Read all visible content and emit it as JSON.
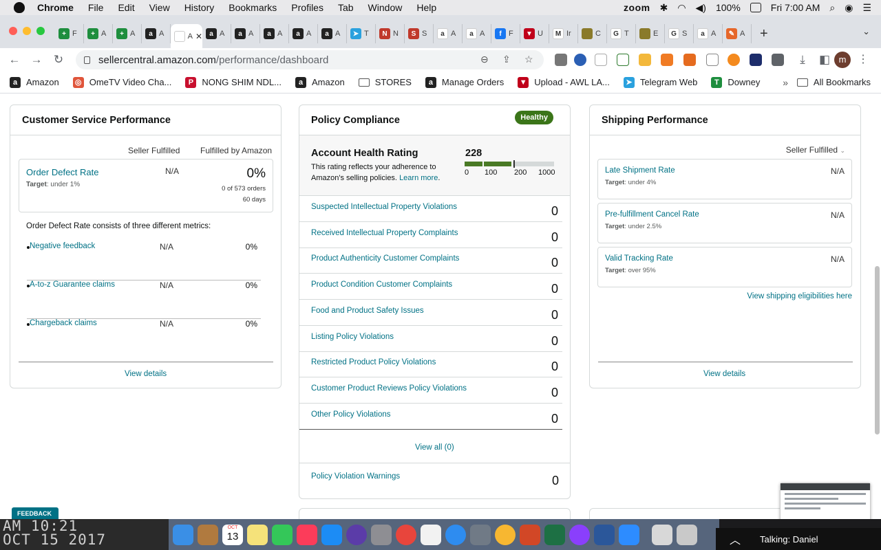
{
  "menubar": {
    "app": "Chrome",
    "items": [
      "File",
      "Edit",
      "View",
      "History",
      "Bookmarks",
      "Profiles",
      "Tab",
      "Window",
      "Help"
    ],
    "zoom": "zoom",
    "battery": "100%",
    "clock": "Fri 7:00 AM"
  },
  "tabs": [
    {
      "label": "F",
      "color": "#1e8e3e",
      "glyph": "+"
    },
    {
      "label": "A",
      "color": "#1e8e3e",
      "glyph": "+"
    },
    {
      "label": "A",
      "color": "#1e8e3e",
      "glyph": "+"
    },
    {
      "label": "A",
      "color": "#222222",
      "glyph": "a"
    },
    {
      "label": "A",
      "color": "#ffffff",
      "glyph": "",
      "active": true
    },
    {
      "label": "A",
      "color": "#222222",
      "glyph": "a"
    },
    {
      "label": "A",
      "color": "#222222",
      "glyph": "a"
    },
    {
      "label": "A",
      "color": "#222222",
      "glyph": "a"
    },
    {
      "label": "A",
      "color": "#222222",
      "glyph": "a"
    },
    {
      "label": "A",
      "color": "#222222",
      "glyph": "a"
    },
    {
      "label": "T",
      "color": "#2aa1de",
      "glyph": "➤"
    },
    {
      "label": "N",
      "color": "#c0392b",
      "glyph": "N"
    },
    {
      "label": "S",
      "color": "#c0392b",
      "glyph": "S"
    },
    {
      "label": "A",
      "color": "#ffffff",
      "glyph": "a"
    },
    {
      "label": "A",
      "color": "#ffffff",
      "glyph": "a"
    },
    {
      "label": "F",
      "color": "#1877f2",
      "glyph": "f"
    },
    {
      "label": "U",
      "color": "#c0001a",
      "glyph": "▼"
    },
    {
      "label": "Ir",
      "color": "#ffffff",
      "glyph": "M"
    },
    {
      "label": "C",
      "color": "#8a7a2a",
      "glyph": ""
    },
    {
      "label": "T",
      "color": "#ffffff",
      "glyph": "G"
    },
    {
      "label": "E",
      "color": "#8a7a2a",
      "glyph": ""
    },
    {
      "label": "S",
      "color": "#ffffff",
      "glyph": "G"
    },
    {
      "label": "A",
      "color": "#ffffff",
      "glyph": "a"
    },
    {
      "label": "A",
      "color": "#e6672a",
      "glyph": "✎"
    }
  ],
  "toolbar": {
    "url_host": "sellercentral.amazon.com",
    "url_path": "/performance/dashboard",
    "avatar_letter": "m"
  },
  "bookmarks": [
    {
      "label": "Amazon",
      "color": "#222222",
      "glyph": "a"
    },
    {
      "label": "OmeTV Video Cha...",
      "color": "#e0553b",
      "glyph": "◎"
    },
    {
      "label": "NONG SHIM NDL...",
      "color": "#c8102e",
      "glyph": "P"
    },
    {
      "label": "Amazon",
      "color": "#222222",
      "glyph": "a"
    },
    {
      "label": "STORES",
      "color": "#ffffff",
      "glyph": ""
    },
    {
      "label": "Manage Orders",
      "color": "#222222",
      "glyph": "a"
    },
    {
      "label": "Upload - AWL LA...",
      "color": "#c0001a",
      "glyph": "▼"
    },
    {
      "label": "Telegram Web",
      "color": "#2aa1de",
      "glyph": "➤"
    },
    {
      "label": "Downey",
      "color": "#1e8e3e",
      "glyph": "T"
    }
  ],
  "bookmarks_more": "»",
  "bookmarks_all": "All Bookmarks",
  "csp": {
    "title": "Customer Service Performance",
    "col_seller": "Seller Fulfilled",
    "col_fba": "Fulfilled by Amazon",
    "odr_label": "Order Defect Rate",
    "odr_target_prefix": "Target",
    "odr_target": ": under 1%",
    "odr_seller": "N/A",
    "odr_fba": "0%",
    "odr_orders": "0 of 573 orders",
    "odr_days": "60 days",
    "consists": "Order Defect Rate consists of three different metrics:",
    "metrics": [
      {
        "label": "Negative feedback",
        "seller": "N/A",
        "fba": "0%"
      },
      {
        "label": "A-to-z Guarantee claims",
        "seller": "N/A",
        "fba": "0%"
      },
      {
        "label": "Chargeback claims",
        "seller": "N/A",
        "fba": "0%"
      }
    ],
    "view_details": "View details"
  },
  "policy": {
    "title": "Policy Compliance",
    "badge": "Healthy",
    "ahr_title": "Account Health Rating",
    "ahr_desc_1": "This rating reflects your adherence to",
    "ahr_desc_2": "Amazon's selling policies.",
    "learn_more": "Learn more",
    "ahr_value": "228",
    "ahr_level": 228,
    "ticks": [
      "0",
      "100",
      "200",
      "1000"
    ],
    "violations": [
      {
        "label": "Suspected Intellectual Property Violations",
        "count": "0"
      },
      {
        "label": "Received Intellectual Property Complaints",
        "count": "0"
      },
      {
        "label": "Product Authenticity Customer Complaints",
        "count": "0"
      },
      {
        "label": "Product Condition Customer Complaints",
        "count": "0"
      },
      {
        "label": "Food and Product Safety Issues",
        "count": "0"
      },
      {
        "label": "Listing Policy Violations",
        "count": "0"
      },
      {
        "label": "Restricted Product Policy Violations",
        "count": "0"
      },
      {
        "label": "Customer Product Reviews Policy Violations",
        "count": "0"
      },
      {
        "label": "Other Policy Violations",
        "count": "0"
      }
    ],
    "view_all": "View all (0)",
    "warnings_label": "Policy Violation Warnings",
    "warnings_count": "0"
  },
  "shipping": {
    "title": "Shipping Performance",
    "filter": "Seller Fulfilled",
    "metrics": [
      {
        "label": "Late Shipment Rate",
        "target_prefix": "Target",
        "target": ": under 4%",
        "value": "N/A"
      },
      {
        "label": "Pre-fulfillment Cancel Rate",
        "target_prefix": "Target",
        "target": ": under 2.5%",
        "value": "N/A"
      },
      {
        "label": "Valid Tracking Rate",
        "target_prefix": "Target",
        "target": ": over 95%",
        "value": "N/A"
      }
    ],
    "eligibility_link": "View shipping eligibilities here",
    "view_details": "View details"
  },
  "feedback": "FEEDBACK ✕",
  "clock_photo": {
    "line1": "AM 10:21",
    "line2": "OCT 15 2017"
  },
  "dock_calendar_month": "OCT",
  "dock_calendar_day": "13",
  "talking": "Talking: Daniel",
  "colors": {
    "healthy": "#3b7519",
    "link": "#007185",
    "bar_fill": "#4a7a25",
    "bar_rest": "#d5d9d9"
  }
}
